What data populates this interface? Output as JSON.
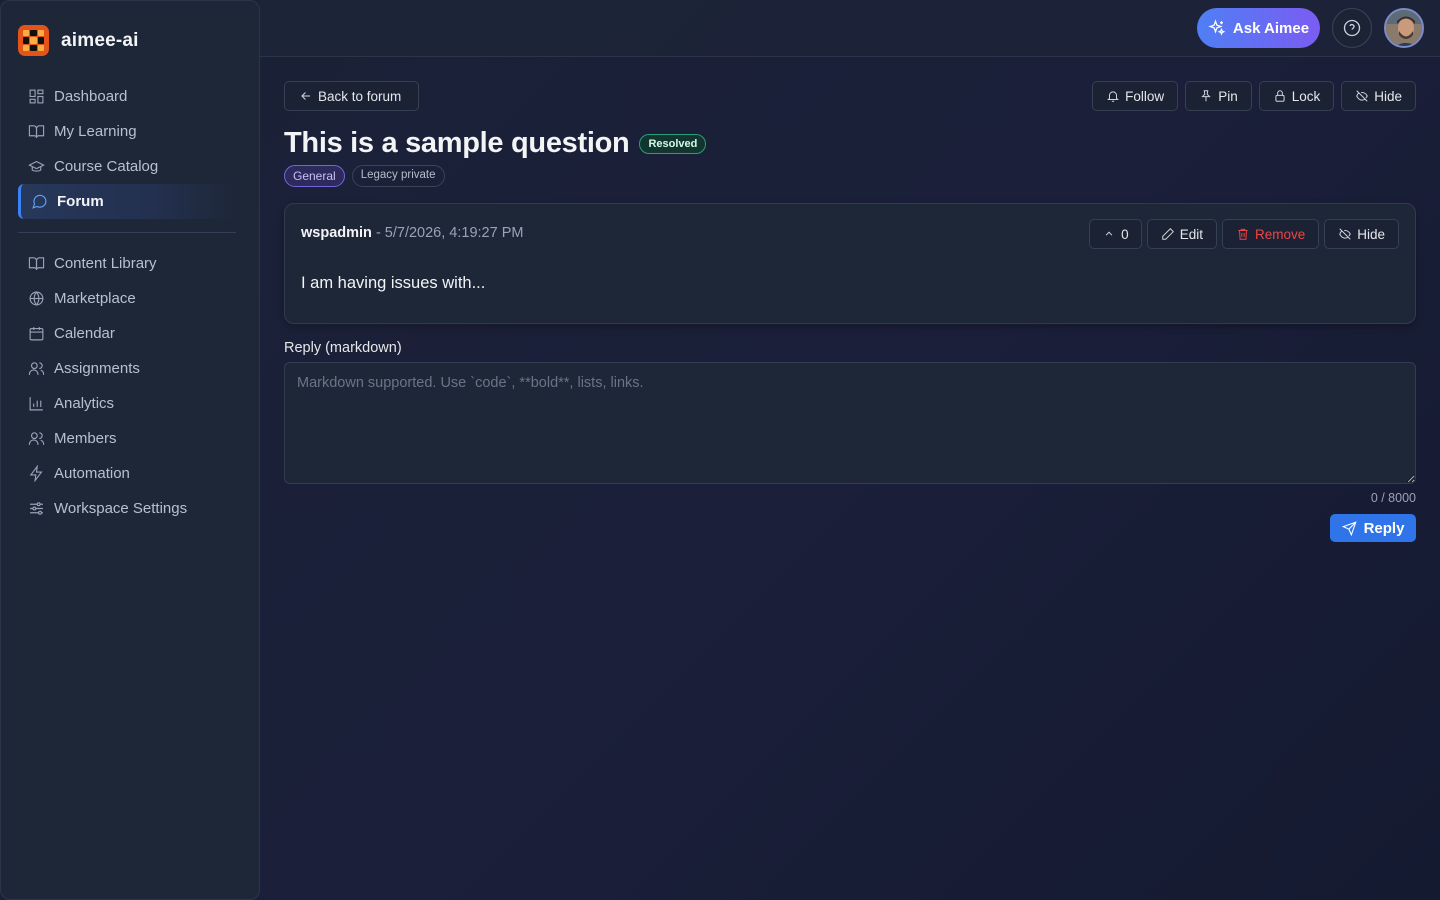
{
  "brand": {
    "name": "aimee-ai"
  },
  "sidebar": {
    "primary": [
      {
        "label": "Dashboard",
        "icon": "dashboard-icon"
      },
      {
        "label": "My Learning",
        "icon": "book-open-icon"
      },
      {
        "label": "Course Catalog",
        "icon": "graduation-cap-icon"
      },
      {
        "label": "Forum",
        "icon": "message-circle-icon",
        "active": true
      }
    ],
    "secondary": [
      {
        "label": "Content Library",
        "icon": "book-open-icon"
      },
      {
        "label": "Marketplace",
        "icon": "globe-icon"
      },
      {
        "label": "Calendar",
        "icon": "calendar-icon"
      },
      {
        "label": "Assignments",
        "icon": "users-icon"
      },
      {
        "label": "Analytics",
        "icon": "bar-chart-icon"
      },
      {
        "label": "Members",
        "icon": "users-icon"
      },
      {
        "label": "Automation",
        "icon": "zap-icon"
      },
      {
        "label": "Workspace Settings",
        "icon": "sliders-icon"
      }
    ]
  },
  "topbar": {
    "ask_label": "Ask Aimee"
  },
  "thread": {
    "back_label": "Back to forum",
    "actions": {
      "follow": "Follow",
      "pin": "Pin",
      "lock": "Lock",
      "hide": "Hide"
    },
    "title": "This is a sample question",
    "status_badge": "Resolved",
    "tags": [
      "General",
      "Legacy private"
    ]
  },
  "post": {
    "author": "wspadmin",
    "timestamp": "- 5/7/2026, 4:19:27 PM",
    "vote_count": "0",
    "edit_label": "Edit",
    "remove_label": "Remove",
    "hide_label": "Hide",
    "body": "I am having issues with..."
  },
  "reply": {
    "label": "Reply (markdown)",
    "placeholder": "Markdown supported. Use `code`, **bold**, lists, links.",
    "value": "",
    "char_count": "0 / 8000",
    "submit_label": "Reply"
  },
  "colors": {
    "accent": "#3b82f6",
    "ask_gradient_start": "#4f7ff5",
    "ask_gradient_end": "#7b5cf2",
    "danger": "#ef4444",
    "success": "#2a9d7a",
    "brand_logo": "#e4531a"
  }
}
